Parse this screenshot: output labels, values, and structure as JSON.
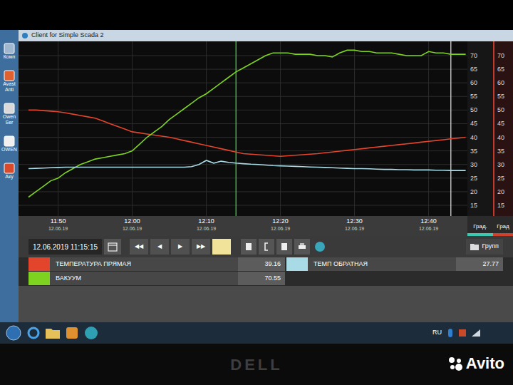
{
  "desktop_icons": [
    {
      "label": "Комп"
    },
    {
      "label": "Avast Anti"
    },
    {
      "label": "Owen Ser"
    },
    {
      "label": "OWEN"
    },
    {
      "label": "Аку"
    }
  ],
  "window": {
    "title": "Client for Simple Scada 2"
  },
  "chart": {
    "y_min": 15,
    "y_max": 70,
    "y_ticks": [
      "70",
      "65",
      "60",
      "55",
      "50",
      "45",
      "40",
      "35",
      "30",
      "25",
      "20",
      "15"
    ],
    "y_ticks_right": [
      "70",
      "65",
      "60",
      "55",
      "50",
      "45",
      "40",
      "35",
      "30",
      "25",
      "20",
      "15"
    ],
    "series_start": "11:46",
    "step_minutes": 1,
    "x_ticks": [
      {
        "time": "11:50",
        "date": "12.06.19"
      },
      {
        "time": "12:00",
        "date": "12.06.19"
      },
      {
        "time": "12:10",
        "date": "12.06.19"
      },
      {
        "time": "12:20",
        "date": "12.06.19"
      },
      {
        "time": "12:30",
        "date": "12.06.19"
      },
      {
        "time": "12:40",
        "date": "12.06.19"
      }
    ],
    "series": [
      {
        "name": "ТЕМПЕРАТУРА ПРЯМАЯ",
        "reading": "39.16",
        "color": "#e2452c",
        "values": [
          50,
          50,
          49.8,
          49.6,
          49.4,
          49,
          48.5,
          48,
          47.5,
          47,
          46,
          45,
          44,
          43,
          42,
          41.6,
          41.2,
          40.8,
          40.4,
          40,
          39.4,
          38.8,
          38.2,
          37.6,
          37,
          36.4,
          35.8,
          35.2,
          34.6,
          34,
          33.8,
          33.6,
          33.4,
          33.2,
          33,
          33.2,
          33.4,
          33.6,
          33.8,
          34,
          34.3,
          34.6,
          34.9,
          35.2,
          35.5,
          35.8,
          36.1,
          36.4,
          36.7,
          37,
          37.3,
          37.6,
          37.9,
          38.2,
          38.5,
          38.8,
          39.1,
          39.4,
          39.7,
          40
        ]
      },
      {
        "name": "ВАКУУМ",
        "reading": "70.55",
        "color": "#7ed321",
        "values": [
          18,
          20,
          22,
          24,
          25,
          27,
          28.5,
          30,
          31,
          32,
          32.5,
          33,
          33.5,
          34,
          35,
          37.5,
          40,
          42,
          44,
          46.5,
          48.5,
          50.5,
          52.5,
          54.5,
          56,
          58,
          60,
          62,
          64,
          65.5,
          67,
          68.5,
          70,
          71,
          71,
          71,
          70.5,
          70.5,
          70.5,
          70,
          70,
          69.5,
          71,
          72,
          72,
          71.5,
          71.5,
          71,
          71,
          71,
          70.5,
          70,
          70,
          70,
          71.5,
          71,
          71,
          70.5,
          70.5,
          70.5
        ]
      },
      {
        "name": "ТЕМП ОБРАТНАЯ",
        "reading": "27.77",
        "color": "#a8dbe6",
        "values": [
          28.5,
          28.6,
          28.7,
          28.8,
          28.9,
          29,
          29,
          29,
          29,
          29,
          29,
          29,
          29,
          29,
          29,
          29,
          29,
          29,
          29,
          29,
          29,
          29,
          29.2,
          30,
          31.5,
          30.5,
          31.2,
          30.8,
          30.5,
          30.3,
          30.1,
          30,
          29.8,
          29.6,
          29.5,
          29.4,
          29.3,
          29.2,
          29.1,
          29,
          28.9,
          28.8,
          28.7,
          28.6,
          28.5,
          28.5,
          28.4,
          28.3,
          28.2,
          28.2,
          28.1,
          28.1,
          28,
          28,
          28,
          27.9,
          27.9,
          27.8,
          27.8,
          27.8
        ]
      }
    ],
    "cursors": [
      {
        "time": "12:14",
        "color": "#4ed84e"
      },
      {
        "time": "12:43",
        "color": "#e8e8e8"
      }
    ]
  },
  "units": [
    "Град.",
    "Град"
  ],
  "toolbar": {
    "datetime": "12.06.2019 11:15:15",
    "nav_buttons": [
      "◀◀",
      "◀",
      "▶",
      "▶▶"
    ],
    "group": "Групп"
  },
  "taskbar": {
    "language": "RU"
  },
  "bezel": {
    "brand": "DELL"
  },
  "watermark": "Avito"
}
